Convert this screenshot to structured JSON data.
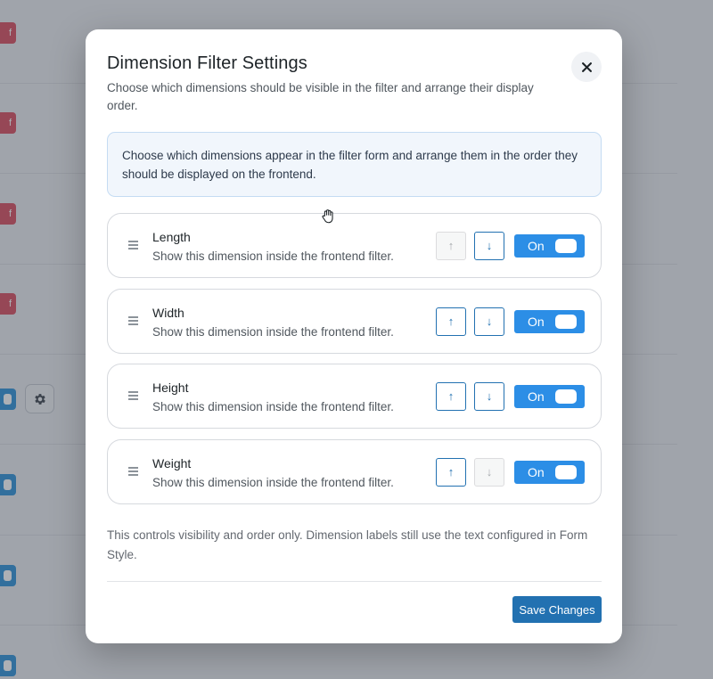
{
  "background": {
    "badge_text": "f"
  },
  "modal": {
    "title": "Dimension Filter Settings",
    "subtitle": "Choose which dimensions should be visible in the filter and arrange their display order.",
    "close_glyph": "✕",
    "info": "Choose which dimensions appear in the filter form and arrange them in the order they should be displayed on the frontend.",
    "dimensions": [
      {
        "name": "Length",
        "description": "Show this dimension inside the frontend filter.",
        "up_enabled": false,
        "down_enabled": true,
        "toggle": "On"
      },
      {
        "name": "Width",
        "description": "Show this dimension inside the frontend filter.",
        "up_enabled": true,
        "down_enabled": true,
        "toggle": "On"
      },
      {
        "name": "Height",
        "description": "Show this dimension inside the frontend filter.",
        "up_enabled": true,
        "down_enabled": true,
        "toggle": "On"
      },
      {
        "name": "Weight",
        "description": "Show this dimension inside the frontend filter.",
        "up_enabled": true,
        "down_enabled": false,
        "toggle": "On"
      }
    ],
    "up_glyph": "↑",
    "down_glyph": "↓",
    "footnote": "This controls visibility and order only. Dimension labels still use the text configured in Form Style.",
    "save_label": "Save Changes"
  },
  "colors": {
    "primary": "#2271b1",
    "toggle_on": "#2c8ee6",
    "info_bg": "#f1f6fc",
    "badge": "#d84b5c"
  },
  "icons": {
    "close": "close-icon",
    "drag": "drag-handle-icon",
    "gear": "gear-icon",
    "cursor": "hand-cursor-icon"
  }
}
